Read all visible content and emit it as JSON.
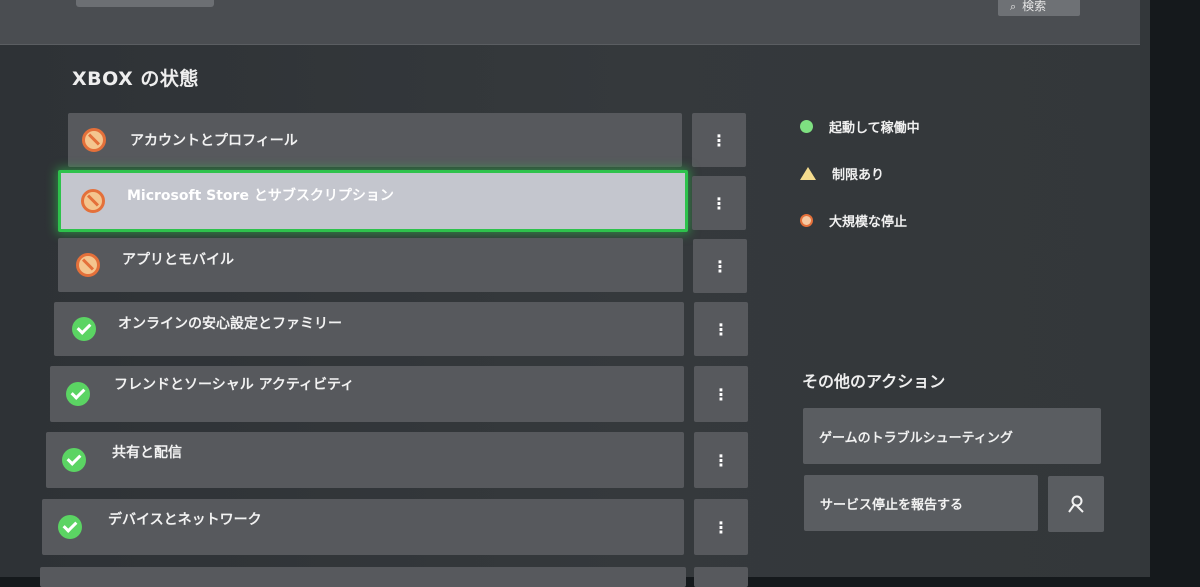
{
  "header": {
    "search_label": "検索",
    "search_icon": "search-icon"
  },
  "section_title": "XBOX の状態",
  "services": [
    {
      "label": "アカウントとプロフィール",
      "status": "outage"
    },
    {
      "label": "Microsoft Store とサブスクリプション",
      "status": "outage",
      "selected": true
    },
    {
      "label": "アプリとモバイル",
      "status": "outage"
    },
    {
      "label": "オンラインの安心設定とファミリー",
      "status": "ok"
    },
    {
      "label": "フレンドとソーシャル アクティビティ",
      "status": "ok"
    },
    {
      "label": "共有と配信",
      "status": "ok"
    },
    {
      "label": "デバイスとネットワーク",
      "status": "ok"
    }
  ],
  "more_glyph": "⋮",
  "legend": {
    "up": "起動して稼働中",
    "limited": "制限あり",
    "major_outage": "大規模な停止"
  },
  "other_actions": {
    "title": "その他のアクション",
    "troubleshoot": "ゲームのトラブルシューティング",
    "report": "サービス停止を報告する",
    "report_icon": "report-person-icon"
  },
  "colors": {
    "ok": "#5bd463",
    "outage": "#e4703a",
    "limited": "#f5dc8e",
    "focus": "#2ec24c"
  }
}
